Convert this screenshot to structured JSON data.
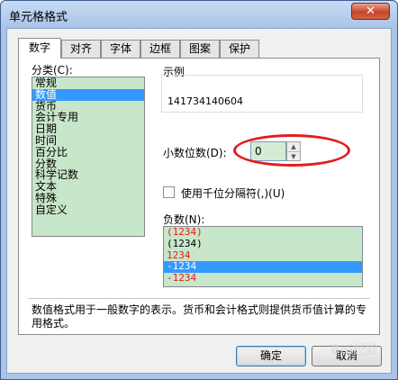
{
  "window": {
    "title": "单元格格式",
    "close_glyph": "✕"
  },
  "tabs": [
    {
      "label": "数字",
      "active": true
    },
    {
      "label": "对齐",
      "active": false
    },
    {
      "label": "字体",
      "active": false
    },
    {
      "label": "边框",
      "active": false
    },
    {
      "label": "图案",
      "active": false
    },
    {
      "label": "保护",
      "active": false
    }
  ],
  "category": {
    "label": "分类(C):",
    "items": [
      "常规",
      "数值",
      "货币",
      "会计专用",
      "日期",
      "时间",
      "百分比",
      "分数",
      "科学记数",
      "文本",
      "特殊",
      "自定义"
    ],
    "selected": "数值"
  },
  "sample": {
    "label": "示例",
    "value": "141734140604"
  },
  "decimal": {
    "label": "小数位数(D):",
    "value": "0"
  },
  "thousands": {
    "label": "使用千位分隔符(,)(U)",
    "checked": false
  },
  "negative": {
    "label": "负数(N):",
    "items": [
      {
        "text": "(1234)",
        "color": "#e81a1a"
      },
      {
        "text": "(1234)",
        "color": "#000000"
      },
      {
        "text": "1234",
        "color": "#e81a1a"
      },
      {
        "text": "-1234",
        "color": "#ffffff",
        "selected": true
      },
      {
        "text": "-1234",
        "color": "#e81a1a"
      }
    ]
  },
  "description": "数值格式用于一般数字的表示。货币和会计格式则提供货币值计算的专用格式。",
  "buttons": {
    "ok": "确定",
    "cancel": "取消"
  },
  "colors": {
    "list_bg": "#c8e6c9",
    "selection": "#3399ff",
    "annotation": "#e21c1c"
  },
  "watermark": "Bai经验"
}
